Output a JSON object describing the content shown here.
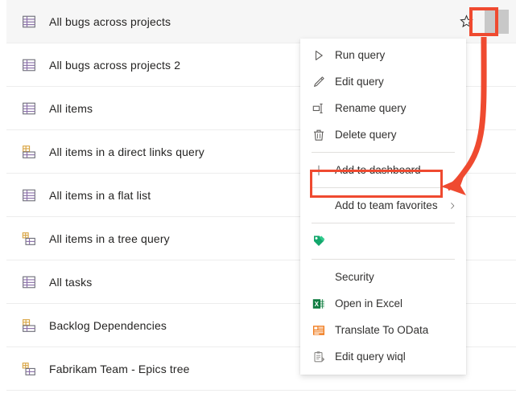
{
  "queries": {
    "rows": [
      {
        "label": "All bugs across projects",
        "icon": "flat-query-icon",
        "hovered": true
      },
      {
        "label": "All bugs across projects 2",
        "icon": "flat-query-icon",
        "hovered": false
      },
      {
        "label": "All items",
        "icon": "flat-query-icon",
        "hovered": false
      },
      {
        "label": "All items in a direct links query",
        "icon": "direct-links-query-icon",
        "hovered": false
      },
      {
        "label": "All items in a flat list",
        "icon": "flat-query-icon",
        "hovered": false
      },
      {
        "label": "All items in a tree query",
        "icon": "tree-query-icon",
        "hovered": false
      },
      {
        "label": "All tasks",
        "icon": "flat-query-icon",
        "hovered": false
      },
      {
        "label": "Backlog Dependencies",
        "icon": "direct-links-query-icon",
        "hovered": false
      },
      {
        "label": "Fabrikam Team - Epics tree",
        "icon": "tree-query-icon",
        "hovered": false
      }
    ],
    "row_actions": {
      "favorite_icon": "star-icon",
      "more_icon": "more-options-icon"
    }
  },
  "context_menu": {
    "items": [
      {
        "label": "Run query",
        "icon": "play-icon",
        "type": "item"
      },
      {
        "label": "Edit query",
        "icon": "pencil-icon",
        "type": "item"
      },
      {
        "label": "Rename query",
        "icon": "rename-icon",
        "type": "item"
      },
      {
        "label": "Delete query",
        "icon": "trash-icon",
        "type": "item"
      },
      {
        "type": "separator"
      },
      {
        "label": "Add to dashboard",
        "icon": "plus-icon",
        "type": "item",
        "highlighted": true
      },
      {
        "type": "separator"
      },
      {
        "label": "Add to team favorites",
        "icon": "none",
        "type": "submenu",
        "chevron": "chevron-right-icon"
      },
      {
        "type": "separator"
      },
      {
        "label": "",
        "icon": "tag-icon",
        "type": "item"
      },
      {
        "type": "separator"
      },
      {
        "label": "Security",
        "icon": "none",
        "type": "item"
      },
      {
        "label": "Open in Excel",
        "icon": "excel-icon",
        "type": "item"
      },
      {
        "label": "Translate To OData",
        "icon": "odata-icon",
        "type": "item"
      },
      {
        "label": "Edit query wiql",
        "icon": "wiql-icon",
        "type": "item"
      }
    ]
  },
  "annotation": {
    "highlight_color": "#ef4a30",
    "arrow": "curved-arrow-from-more-button-to-add-to-dashboard"
  },
  "colors": {
    "accent_red": "#ef4a30",
    "excel_green": "#107c41",
    "odata_orange": "#f07b1d",
    "tag_green": "#13a76c",
    "text": "#323130",
    "row_hover": "#f6f6f6",
    "divider": "#ededed"
  }
}
